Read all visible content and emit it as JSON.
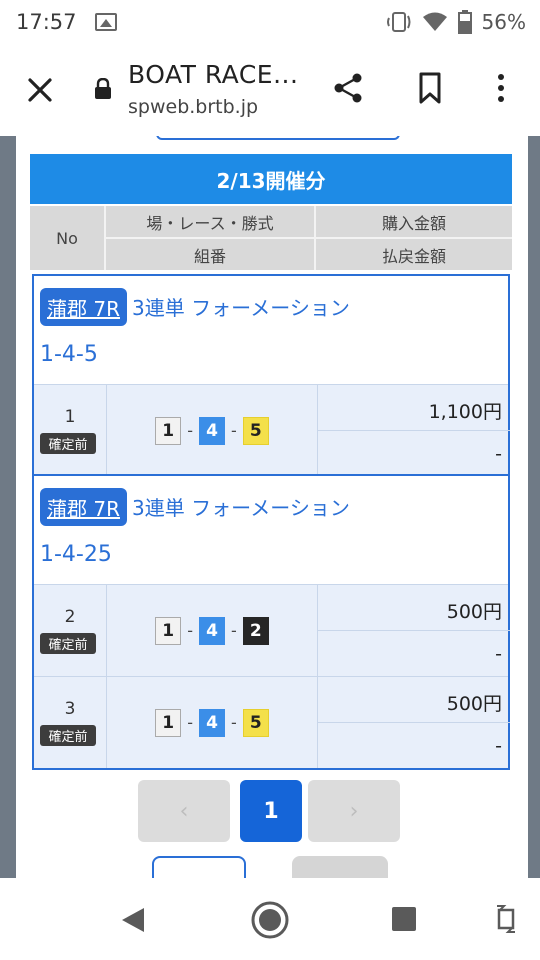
{
  "status_bar": {
    "time": "17:57",
    "battery": "56%"
  },
  "browser": {
    "site_title": "BOAT RACE...",
    "url": "spweb.brtb.jp"
  },
  "page": {
    "date_header": "2/13開催分",
    "columns": {
      "no": "No",
      "race": "場・レース・勝式",
      "amount": "購入金額",
      "combination": "組番",
      "payout": "払戻金額"
    },
    "tickets": [
      {
        "venue": "蒲郡 7R",
        "bet_type": "3連単 フォーメーション",
        "combo_title": "1-4-5",
        "rows": [
          {
            "no": "1",
            "status": "確定前",
            "boats": [
              "1",
              "4",
              "5"
            ],
            "amount": "1,100円",
            "payout": "-"
          }
        ]
      },
      {
        "venue": "蒲郡 7R",
        "bet_type": "3連単 フォーメーション",
        "combo_title": "1-4-25",
        "rows": [
          {
            "no": "2",
            "status": "確定前",
            "boats": [
              "1",
              "4",
              "2"
            ],
            "amount": "500円",
            "payout": "-"
          },
          {
            "no": "3",
            "status": "確定前",
            "boats": [
              "1",
              "4",
              "5"
            ],
            "amount": "500円",
            "payout": "-"
          }
        ]
      }
    ],
    "pagination": {
      "prev": "‹",
      "current": "1",
      "next": "›"
    }
  },
  "colors": {
    "accent": "#1e8be6",
    "ticket_border": "#2a6fd6",
    "row_bg": "#e8effa",
    "boat_1": "#f2f2f2",
    "boat_2": "#262626",
    "boat_4": "#3b8ee8",
    "boat_5": "#f4e04a"
  },
  "icons": {
    "close": "close-icon",
    "lock": "lock-icon",
    "share": "share-icon",
    "bookmark": "bookmark-icon",
    "more": "more-vert-icon"
  }
}
